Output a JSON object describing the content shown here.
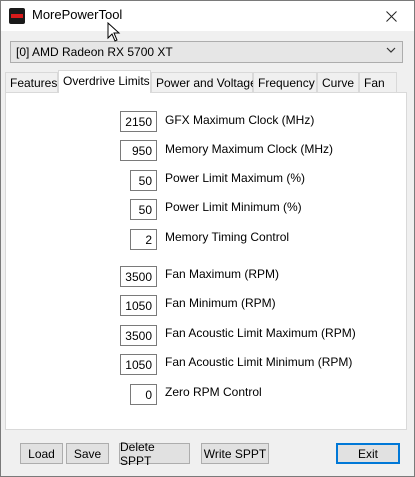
{
  "window": {
    "title": "MorePowerTool"
  },
  "device_select": {
    "value": "[0] AMD Radeon RX 5700 XT"
  },
  "tabs": [
    {
      "label": "Features"
    },
    {
      "label": "Overdrive Limits"
    },
    {
      "label": "Power and Voltage"
    },
    {
      "label": "Frequency"
    },
    {
      "label": "Curve"
    },
    {
      "label": "Fan"
    }
  ],
  "active_tab": "Overdrive Limits",
  "fields": [
    {
      "value": "2150",
      "label": "GFX Maximum Clock (MHz)"
    },
    {
      "value": "950",
      "label": "Memory Maximum Clock (MHz)"
    },
    {
      "value": "50",
      "label": "Power Limit Maximum (%)"
    },
    {
      "value": "50",
      "label": "Power Limit Minimum (%)"
    },
    {
      "value": "2",
      "label": "Memory Timing Control"
    },
    {
      "value": "3500",
      "label": "Fan Maximum (RPM)"
    },
    {
      "value": "1050",
      "label": "Fan Minimum (RPM)"
    },
    {
      "value": "3500",
      "label": "Fan Acoustic Limit Maximum (RPM)"
    },
    {
      "value": "1050",
      "label": "Fan Acoustic Limit Minimum (RPM)"
    },
    {
      "value": "0",
      "label": "Zero RPM Control"
    }
  ],
  "buttons": {
    "load": "Load",
    "save": "Save",
    "delete_sppt": "Delete SPPT",
    "write_sppt": "Write SPPT",
    "exit": "Exit"
  },
  "icons": {
    "app": "app-icon",
    "close": "close-icon",
    "chevron": "chevron-down-icon",
    "cursor": "mouse-cursor-icon"
  }
}
